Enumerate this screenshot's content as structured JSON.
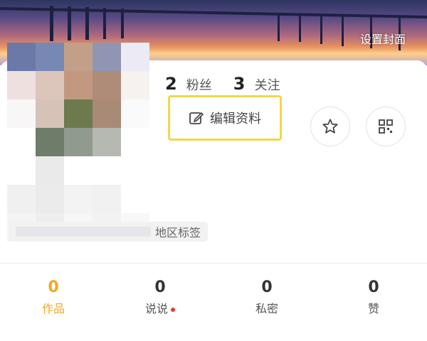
{
  "header": {
    "set_cover_label": "设置封面"
  },
  "stats": {
    "followers": {
      "count": "2",
      "label": "粉丝"
    },
    "following": {
      "count": "3",
      "label": "关注"
    }
  },
  "actions": {
    "edit_profile_label": "编辑资料",
    "icons": [
      "edit-icon",
      "star-icon",
      "qrcode-icon"
    ],
    "highlight_color": "#f4d64a"
  },
  "profile": {
    "region_tag_label": "地区标签"
  },
  "tabs": [
    {
      "count": "0",
      "label": "作品",
      "active": true
    },
    {
      "count": "0",
      "label": "说说",
      "has_dot": true
    },
    {
      "count": "0",
      "label": "私密"
    },
    {
      "count": "0",
      "label": "赞"
    }
  ],
  "colors": {
    "accent": "#f5a623",
    "dot": "#e53935"
  }
}
